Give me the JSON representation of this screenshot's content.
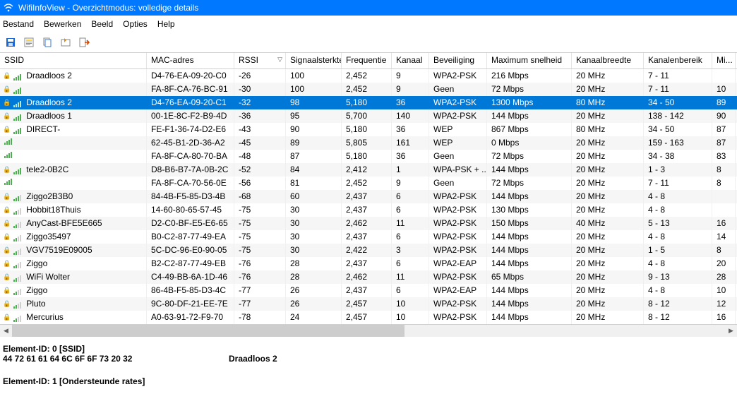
{
  "title": "WifiInfoView   -   Overzichtmodus: volledige details",
  "menu": [
    "Bestand",
    "Bewerken",
    "Beeld",
    "Opties",
    "Help"
  ],
  "columns": [
    "SSID",
    "MAC-adres",
    "RSSI",
    "Signaalsterkte",
    "Frequentie",
    "Kanaal",
    "Beveiliging",
    "Maximum snelheid",
    "Kanaalbreedte",
    "Kanalenbereik",
    "Mi..."
  ],
  "sort_col": 2,
  "rows": [
    {
      "lock": true,
      "bars": 4,
      "ssid": "Draadloos 2",
      "mac": "D4-76-EA-09-20-C0",
      "rssi": "-26",
      "sig": "100",
      "freq": "2,452",
      "chan": "9",
      "sec": "WPA2-PSK",
      "max": "216 Mbps",
      "bw": "20 MHz",
      "range": "7 - 11",
      "last": ""
    },
    {
      "lock": true,
      "bars": 4,
      "ssid": "",
      "mac": "FA-8F-CA-76-BC-91",
      "rssi": "-30",
      "sig": "100",
      "freq": "2,452",
      "chan": "9",
      "sec": "Geen",
      "max": "72 Mbps",
      "bw": "20 MHz",
      "range": "7 - 11",
      "last": "10"
    },
    {
      "lock": true,
      "bars": 4,
      "sel": true,
      "ssid": "Draadloos 2",
      "mac": "D4-76-EA-09-20-C1",
      "rssi": "-32",
      "sig": "98",
      "freq": "5,180",
      "chan": "36",
      "sec": "WPA2-PSK",
      "max": "1300 Mbps",
      "bw": "80 MHz",
      "range": "34 - 50",
      "last": "89"
    },
    {
      "lock": true,
      "bars": 4,
      "ssid": "Draadloos 1",
      "mac": "00-1E-8C-F2-B9-4D",
      "rssi": "-36",
      "sig": "95",
      "freq": "5,700",
      "chan": "140",
      "sec": "WPA2-PSK",
      "max": "144 Mbps",
      "bw": "20 MHz",
      "range": "138 - 142",
      "last": "90"
    },
    {
      "lock": true,
      "bars": 4,
      "ssid": "DIRECT-",
      "mac": "FE-F1-36-74-D2-E6",
      "rssi": "-43",
      "sig": "90",
      "freq": "5,180",
      "chan": "36",
      "sec": "WEP",
      "max": "867 Mbps",
      "bw": "80 MHz",
      "range": "34 - 50",
      "last": "87"
    },
    {
      "lock": false,
      "bars": 4,
      "ssid": "",
      "mac": "62-45-B1-2D-36-A2",
      "rssi": "-45",
      "sig": "89",
      "freq": "5,805",
      "chan": "161",
      "sec": "WEP",
      "max": "0 Mbps",
      "bw": "20 MHz",
      "range": "159 - 163",
      "last": "87"
    },
    {
      "lock": false,
      "bars": 4,
      "ssid": "",
      "mac": "FA-8F-CA-80-70-BA",
      "rssi": "-48",
      "sig": "87",
      "freq": "5,180",
      "chan": "36",
      "sec": "Geen",
      "max": "72 Mbps",
      "bw": "20 MHz",
      "range": "34 - 38",
      "last": "83"
    },
    {
      "lock": true,
      "bars": 4,
      "ssid": "tele2-0B2C",
      "mac": "D8-B6-B7-7A-0B-2C",
      "rssi": "-52",
      "sig": "84",
      "freq": "2,412",
      "chan": "1",
      "sec": "WPA-PSK + ...",
      "max": "144 Mbps",
      "bw": "20 MHz",
      "range": "1 - 3",
      "last": "8"
    },
    {
      "lock": false,
      "bars": 4,
      "ssid": "",
      "mac": "FA-8F-CA-70-56-0E",
      "rssi": "-56",
      "sig": "81",
      "freq": "2,452",
      "chan": "9",
      "sec": "Geen",
      "max": "72 Mbps",
      "bw": "20 MHz",
      "range": "7 - 11",
      "last": "8"
    },
    {
      "lock": true,
      "bars": 3,
      "ssid": "Ziggo2B3B0",
      "mac": "84-4B-F5-85-D3-4B",
      "rssi": "-68",
      "sig": "60",
      "freq": "2,437",
      "chan": "6",
      "sec": "WPA2-PSK",
      "max": "144 Mbps",
      "bw": "20 MHz",
      "range": "4 - 8",
      "last": ""
    },
    {
      "lock": true,
      "bars": 2,
      "ssid": "Hobbit18Thuis",
      "mac": "14-60-80-65-57-45",
      "rssi": "-75",
      "sig": "30",
      "freq": "2,437",
      "chan": "6",
      "sec": "WPA2-PSK",
      "max": "130 Mbps",
      "bw": "20 MHz",
      "range": "4 - 8",
      "last": ""
    },
    {
      "lock": true,
      "bars": 2,
      "ssid": "AnyCast-BFE5E665",
      "mac": "D2-C0-BF-E5-E6-65",
      "rssi": "-75",
      "sig": "30",
      "freq": "2,462",
      "chan": "11",
      "sec": "WPA2-PSK",
      "max": "150 Mbps",
      "bw": "40 MHz",
      "range": "5 - 13",
      "last": "16"
    },
    {
      "lock": true,
      "bars": 2,
      "ssid": "Ziggo35497",
      "mac": "B0-C2-87-77-49-EA",
      "rssi": "-75",
      "sig": "30",
      "freq": "2,437",
      "chan": "6",
      "sec": "WPA2-PSK",
      "max": "144 Mbps",
      "bw": "20 MHz",
      "range": "4 - 8",
      "last": "14"
    },
    {
      "lock": true,
      "bars": 2,
      "ssid": "VGV7519E09005",
      "mac": "5C-DC-96-E0-90-05",
      "rssi": "-75",
      "sig": "30",
      "freq": "2,422",
      "chan": "3",
      "sec": "WPA2-PSK",
      "max": "144 Mbps",
      "bw": "20 MHz",
      "range": "1 - 5",
      "last": "8"
    },
    {
      "lock": true,
      "bars": 2,
      "ssid": "Ziggo",
      "mac": "B2-C2-87-77-49-EB",
      "rssi": "-76",
      "sig": "28",
      "freq": "2,437",
      "chan": "6",
      "sec": "WPA2-EAP",
      "max": "144 Mbps",
      "bw": "20 MHz",
      "range": "4 - 8",
      "last": "20"
    },
    {
      "lock": true,
      "bars": 2,
      "ssid": "WiFi Wolter",
      "mac": "C4-49-BB-6A-1D-46",
      "rssi": "-76",
      "sig": "28",
      "freq": "2,462",
      "chan": "11",
      "sec": "WPA2-PSK",
      "max": "65 Mbps",
      "bw": "20 MHz",
      "range": "9 - 13",
      "last": "28"
    },
    {
      "lock": true,
      "bars": 2,
      "ssid": "Ziggo",
      "mac": "86-4B-F5-85-D3-4C",
      "rssi": "-77",
      "sig": "26",
      "freq": "2,437",
      "chan": "6",
      "sec": "WPA2-EAP",
      "max": "144 Mbps",
      "bw": "20 MHz",
      "range": "4 - 8",
      "last": "10"
    },
    {
      "lock": true,
      "bars": 2,
      "ssid": "Pluto",
      "mac": "9C-80-DF-21-EE-7E",
      "rssi": "-77",
      "sig": "26",
      "freq": "2,457",
      "chan": "10",
      "sec": "WPA2-PSK",
      "max": "144 Mbps",
      "bw": "20 MHz",
      "range": "8 - 12",
      "last": "12"
    },
    {
      "lock": true,
      "bars": 2,
      "ssid": "Mercurius",
      "mac": "A0-63-91-72-F9-70",
      "rssi": "-78",
      "sig": "24",
      "freq": "2,457",
      "chan": "10",
      "sec": "WPA2-PSK",
      "max": "144 Mbps",
      "bw": "20 MHz",
      "range": "8 - 12",
      "last": "16"
    }
  ],
  "detail": {
    "line1": "Element-ID: 0  [SSID]",
    "hex": "44 72 61 61 64 6C 6F 6F 73 20 32",
    "decoded": "Draadloos 2",
    "line2": "Element-ID: 1  [Ondersteunde rates]"
  }
}
